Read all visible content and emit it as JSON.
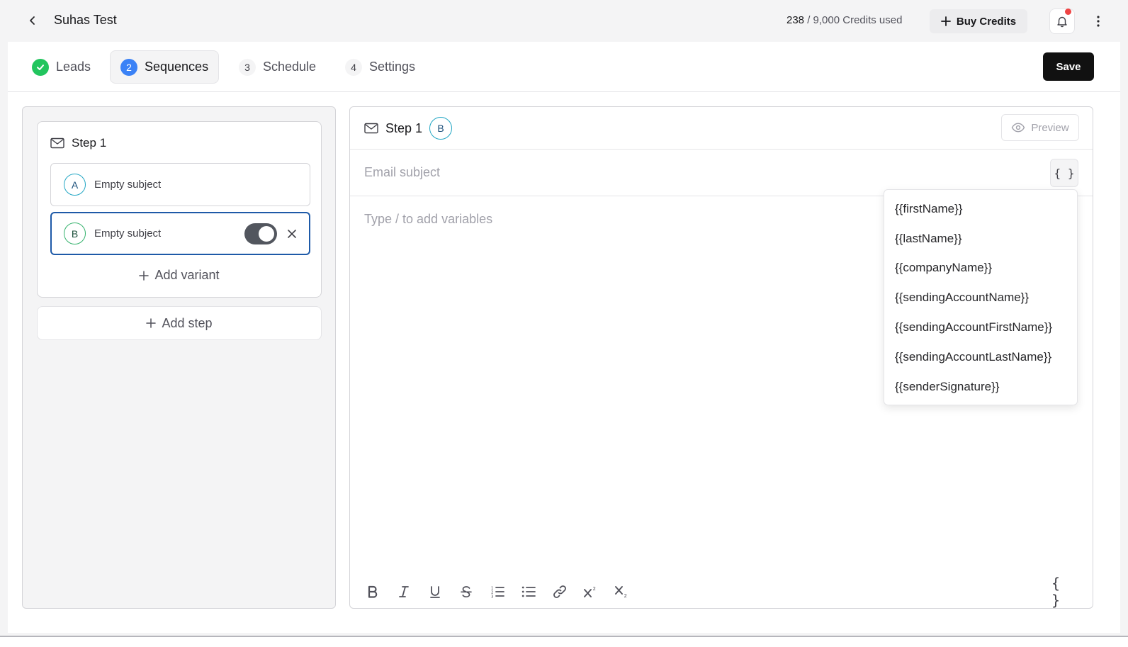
{
  "header": {
    "title": "Suhas Test",
    "credits_used": "238",
    "credits_rest": " / 9,000 Credits used",
    "buy_credits_label": "Buy Credits"
  },
  "steps_nav": {
    "tabs": [
      {
        "number": "",
        "label": "Leads",
        "state": "completed"
      },
      {
        "number": "2",
        "label": "Sequences",
        "state": "active"
      },
      {
        "number": "3",
        "label": "Schedule",
        "state": "pending"
      },
      {
        "number": "4",
        "label": "Settings",
        "state": "pending"
      }
    ],
    "save_label": "Save"
  },
  "sequence": {
    "step_title": "Step 1",
    "variants": [
      {
        "letter": "A",
        "subject": "Empty subject",
        "selected": false
      },
      {
        "letter": "B",
        "subject": "Empty subject",
        "selected": true
      }
    ],
    "add_variant_label": "Add variant",
    "add_step_label": "Add step"
  },
  "editor": {
    "title": "Step 1",
    "variant_letter": "B",
    "preview_label": "Preview",
    "subject_placeholder": "Email subject",
    "variables_icon": "{ }",
    "body_placeholder": "Type / to add variables",
    "toolbar": [
      "bold-icon",
      "italic-icon",
      "underline-icon",
      "strikethrough-icon",
      "ordered-list-icon",
      "bullet-list-icon",
      "link-icon",
      "superscript-icon",
      "subscript-icon"
    ],
    "toolbar_variables_icon": "{ }"
  },
  "variables_dropdown": {
    "items": [
      "{{firstName}}",
      "{{lastName}}",
      "{{companyName}}",
      "{{sendingAccountName}}",
      "{{sendingAccountFirstName}}",
      "{{sendingAccountLastName}}",
      "{{senderSignature}}"
    ]
  },
  "colors": {
    "primary_blue": "#3b82f6",
    "success_green": "#22c55e",
    "selected_border": "#1e5aa8",
    "save_bg": "#111111",
    "notification_dot": "#ef4444"
  }
}
